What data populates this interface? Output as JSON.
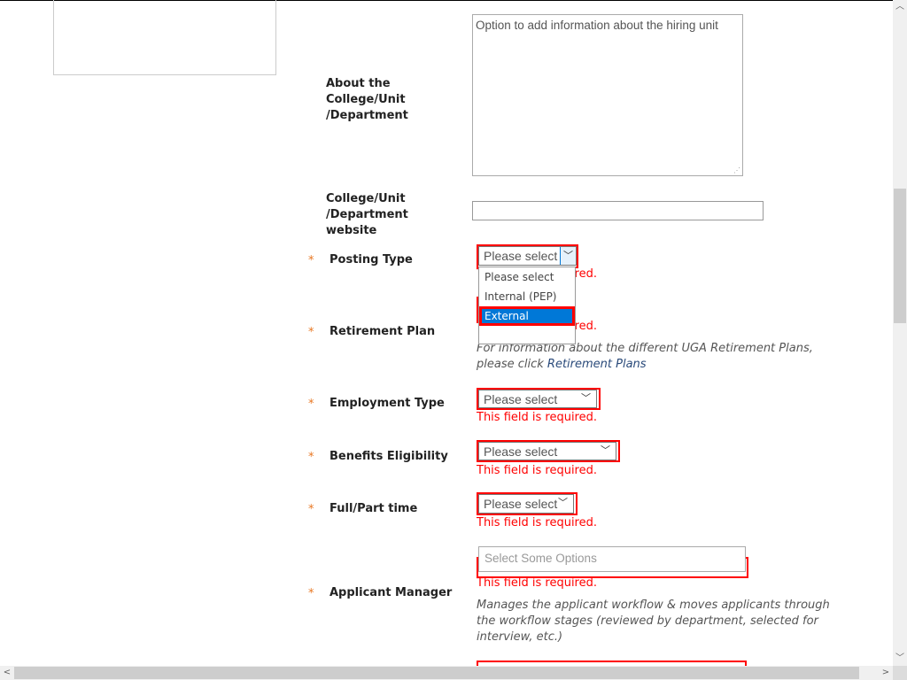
{
  "form": {
    "about": {
      "label": "About the College/Unit /Department",
      "placeholder": "Option to add information about the hiring unit"
    },
    "website": {
      "label": "College/Unit /Department website",
      "value": ""
    },
    "posting_type": {
      "label": "Posting Type",
      "value": "Please select",
      "error": "This field is required.",
      "options": [
        "Please select",
        "Internal (PEP)",
        "External"
      ],
      "highlighted": "External"
    },
    "retirement_plan": {
      "label": "Retirement Plan",
      "error": "This field is required.",
      "help_prefix": "For information about the different UGA Retirement Plans, please click ",
      "help_link": "Retirement Plans"
    },
    "employment_type": {
      "label": "Employment Type",
      "value": "Please select",
      "error": "This field is required."
    },
    "benefits": {
      "label": "Benefits Eligibility",
      "value": "Please select",
      "error": "This field is required."
    },
    "full_part": {
      "label": "Full/Part time",
      "value": "Please select",
      "error": "This field is required."
    },
    "applicant_manager": {
      "label": "Applicant Manager",
      "placeholder": "Select Some Options",
      "error": "This field is required.",
      "help": "Manages the applicant workflow & moves applicants through the workflow stages (reviewed by department, selected for interview, etc.)"
    },
    "required_marker": "*"
  },
  "colors": {
    "error": "#ff0000",
    "required": "#e87722",
    "highlight": "#0078d7"
  }
}
